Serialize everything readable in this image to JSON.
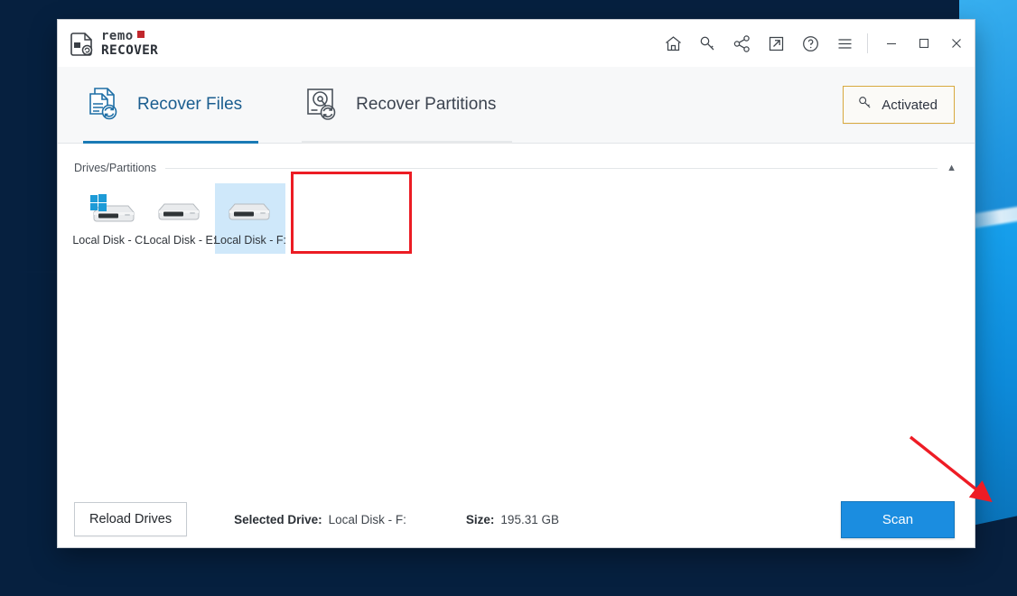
{
  "window": {
    "logo": {
      "mark_icon": "document-recover-icon",
      "brand_primary": "remo",
      "brand_secondary": "RECOVER",
      "accent_color": "#c1272d"
    },
    "title_icons": [
      {
        "name": "home-icon",
        "glyph": "home"
      },
      {
        "name": "key-icon",
        "glyph": "key"
      },
      {
        "name": "share-icon",
        "glyph": "share"
      },
      {
        "name": "external-link-icon",
        "glyph": "arrow-up-right-box"
      },
      {
        "name": "help-icon",
        "glyph": "question-circle"
      },
      {
        "name": "menu-icon",
        "glyph": "hamburger"
      }
    ],
    "controls": [
      {
        "name": "minimize-button",
        "glyph": "minimize"
      },
      {
        "name": "maximize-button",
        "glyph": "maximize"
      },
      {
        "name": "close-button",
        "glyph": "close"
      }
    ]
  },
  "tabs": [
    {
      "label": "Recover Files",
      "icon": "recover-files-icon",
      "active": true
    },
    {
      "label": "Recover Partitions",
      "icon": "recover-partitions-icon",
      "active": false
    }
  ],
  "license": {
    "label": "Activated",
    "icon": "key-icon",
    "border_color": "#d8a93f"
  },
  "drives_panel": {
    "title": "Drives/Partitions",
    "collapse_caret": "▲",
    "drives": [
      {
        "label": "Local Disk - C:",
        "icon": "hard-drive-windows-icon",
        "selected": false
      },
      {
        "label": "Local Disk - E:",
        "icon": "hard-drive-icon",
        "selected": false
      },
      {
        "label": "Local Disk - F:",
        "icon": "hard-drive-icon",
        "selected": true
      }
    ]
  },
  "footer": {
    "reload_label": "Reload Drives",
    "selected_drive_key": "Selected Drive:",
    "selected_drive_value": "Local Disk - F:",
    "size_key": "Size:",
    "size_value": "195.31 GB",
    "scan_label": "Scan",
    "scan_color": "#1b8de0"
  },
  "annotations": {
    "highlight_box_color": "#ec1c24",
    "arrow_color": "#ee1c25",
    "arrow_target": "scan-button"
  }
}
